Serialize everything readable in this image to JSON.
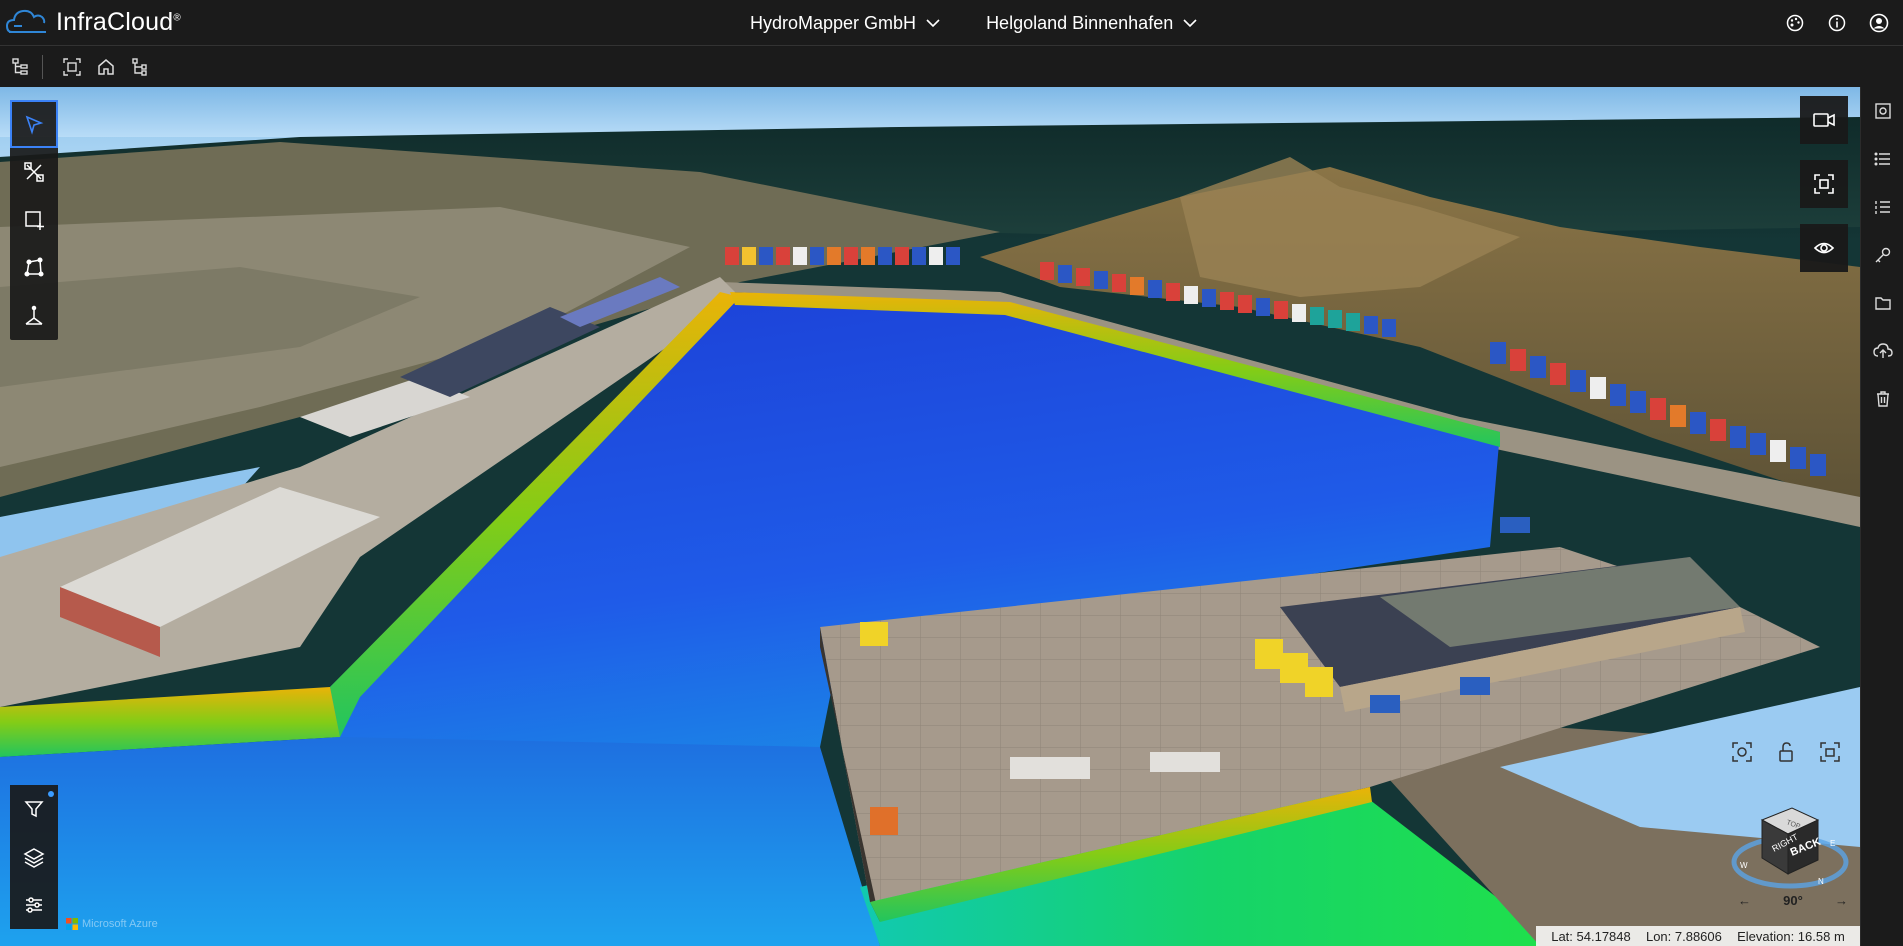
{
  "app": {
    "logo_text": "InfraCloud",
    "logo_mark": "®"
  },
  "header": {
    "organization": "HydroMapper GmbH",
    "project": "Helgoland Binnenhafen",
    "right_icons": [
      "palette-icon",
      "info-icon",
      "account-icon"
    ]
  },
  "toolbar": {
    "icons": [
      "tree-icon",
      "fit-view-icon",
      "home-icon",
      "hierarchy-icon"
    ]
  },
  "left_tools": [
    "select-arrow-icon",
    "measure-tools-icon",
    "add-box-icon",
    "polygon-icon",
    "axis-icon"
  ],
  "left_bottom_tools": [
    "filter-icon",
    "layers-icon",
    "sliders-icon"
  ],
  "right_float_buttons": [
    "video-camera-icon",
    "focus-frame-icon",
    "visibility-eye-icon"
  ],
  "right_rail_icons": [
    "view-panel-icon",
    "list-icon",
    "ordered-list-icon",
    "key-icon",
    "folder-icon",
    "cloud-upload-icon",
    "trash-icon"
  ],
  "navigation": {
    "cube_faces": {
      "right": "RIGHT",
      "back": "BACK",
      "top": "TOP"
    },
    "angle": "90°"
  },
  "attribution": "Microsoft Azure",
  "status": {
    "lat": "Lat: 54.17848",
    "lon": "Lon: 7.88606",
    "elevation": "Elevation: 16.58 m"
  },
  "colors": {
    "accent": "#3b82f6",
    "water_deep": "#1d4fd8",
    "water_shallow": "#1e90ff",
    "depth_high": "#eab308",
    "depth_mid": "#22c55e"
  }
}
